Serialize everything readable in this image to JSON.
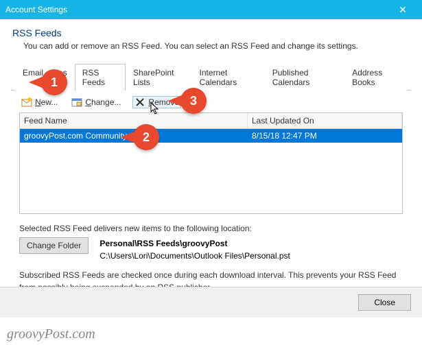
{
  "window": {
    "title": "Account Settings"
  },
  "header": {
    "title": "RSS Feeds",
    "desc": "You can add or remove an RSS Feed. You can select an RSS Feed and change its settings."
  },
  "tabs": [
    {
      "label": "Email"
    },
    {
      "label": "es"
    },
    {
      "label": "RSS Feeds"
    },
    {
      "label": "SharePoint Lists"
    },
    {
      "label": "Internet Calendars"
    },
    {
      "label": "Published Calendars"
    },
    {
      "label": "Address Books"
    }
  ],
  "toolbar": {
    "new": "ew...",
    "change": "hange...",
    "remove": "emove"
  },
  "columns": {
    "feed": "Feed Name",
    "updated": "Last Updated On"
  },
  "rows": [
    {
      "feed": "groovyPost.com Community",
      "updated": "8/15/18 12:47 PM"
    }
  ],
  "location": {
    "intro": "Selected RSS Feed delivers new items to the following location:",
    "change": "Change Folder",
    "folder": "Personal\\RSS Feeds\\groovyPost",
    "path": "C:\\Users\\Lori\\Documents\\Outlook Files\\Personal.pst"
  },
  "note": "Subscribed RSS Feeds are checked once during each download interval. This prevents your RSS Feed from possibly being suspended by an RSS publisher.",
  "close": "Close",
  "watermark": "groovyPost.com",
  "callouts": {
    "c1": "1",
    "c2": "2",
    "c3": "3"
  }
}
